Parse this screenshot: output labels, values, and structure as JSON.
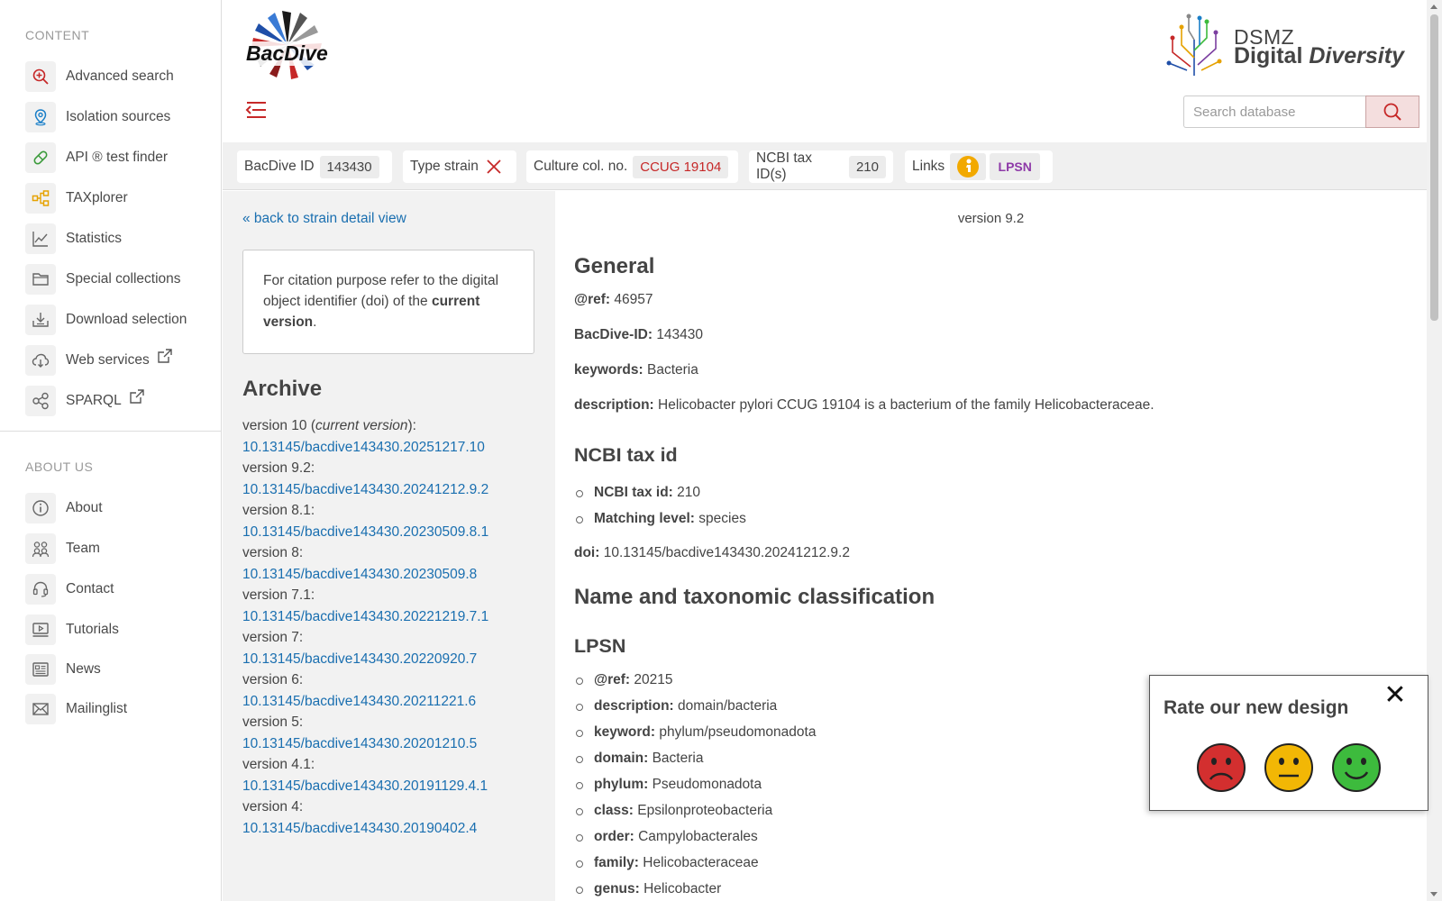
{
  "sidebar": {
    "content_heading": "CONTENT",
    "content_items": [
      {
        "label": "Advanced search",
        "icon": "magnify-plus-icon"
      },
      {
        "label": "Isolation sources",
        "icon": "location-pin-icon"
      },
      {
        "label": "API ® test finder",
        "icon": "pill-icon"
      },
      {
        "label": "TAXplorer",
        "icon": "hierarchy-icon"
      },
      {
        "label": "Statistics",
        "icon": "line-chart-icon"
      },
      {
        "label": "Special collections",
        "icon": "folder-icon"
      },
      {
        "label": "Download selection",
        "icon": "download-icon"
      },
      {
        "label": "Web services",
        "icon": "cloud-download-icon"
      },
      {
        "label": "SPARQL",
        "icon": "share-nodes-icon"
      }
    ],
    "about_heading": "ABOUT US",
    "about_items": [
      {
        "label": "About",
        "icon": "info-icon"
      },
      {
        "label": "Team",
        "icon": "team-icon"
      },
      {
        "label": "Contact",
        "icon": "headset-icon"
      },
      {
        "label": "Tutorials",
        "icon": "tutorial-video-icon"
      },
      {
        "label": "News",
        "icon": "newspaper-icon"
      },
      {
        "label": "Mailinglist",
        "icon": "envelope-icon"
      }
    ]
  },
  "header": {
    "logo_text": "BacDive",
    "partner_logo_top": "DSMZ",
    "partner_logo_bottom_a": "Digital",
    "partner_logo_bottom_b": "Diversity",
    "search_placeholder": "Search database"
  },
  "infobar": {
    "bacdive_id_label": "BacDive ID",
    "bacdive_id_value": "143430",
    "type_strain_label": "Type strain",
    "culture_label": "Culture col. no.",
    "culture_value": "CCUG 19104",
    "ncbi_label": "NCBI tax ID(s)",
    "ncbi_value": "210",
    "links_label": "Links",
    "lpsn_label": "LPSN"
  },
  "left": {
    "back_link": "« back to strain detail view",
    "citation_text": "For citation purpose refer to the digital object identifier (doi) of the ",
    "citation_bold": "current version",
    "citation_end": ".",
    "archive_title": "Archive",
    "archive": [
      {
        "version": "version 10 (",
        "current": "current version",
        "suffix": "):",
        "doi": "10.13145/bacdive143430.20251217.10"
      },
      {
        "version": "version 9.2:",
        "doi": "10.13145/bacdive143430.20241212.9.2"
      },
      {
        "version": "version 8.1:",
        "doi": "10.13145/bacdive143430.20230509.8.1"
      },
      {
        "version": "version 8:",
        "doi": "10.13145/bacdive143430.20230509.8"
      },
      {
        "version": "version 7.1:",
        "doi": "10.13145/bacdive143430.20221219.7.1"
      },
      {
        "version": "version 7:",
        "doi": "10.13145/bacdive143430.20220920.7"
      },
      {
        "version": "version 6:",
        "doi": "10.13145/bacdive143430.20211221.6"
      },
      {
        "version": "version 5:",
        "doi": "10.13145/bacdive143430.20201210.5"
      },
      {
        "version": "version 4.1:",
        "doi": "10.13145/bacdive143430.20191129.4.1"
      },
      {
        "version": "version 4:",
        "doi": "10.13145/bacdive143430.20190402.4"
      }
    ]
  },
  "main": {
    "version_label": "version 9.2",
    "general_title": "General",
    "ref_label": "@ref:",
    "ref_value": "46957",
    "id_label": "BacDive-ID:",
    "id_value": "143430",
    "keywords_label": "keywords:",
    "keywords_value": "Bacteria",
    "description_label": "description:",
    "description_value": "Helicobacter pylori CCUG 19104 is a bacterium of the family Helicobacteraceae.",
    "ncbi_title": "NCBI tax id",
    "ncbi_taxid_label": "NCBI tax id:",
    "ncbi_taxid_value": "210",
    "matching_label": "Matching level:",
    "matching_value": "species",
    "doi_label": "doi:",
    "doi_value": "10.13145/bacdive143430.20241212.9.2",
    "taxonomy_title": "Name and taxonomic classification",
    "lpsn_title": "LPSN",
    "lpsn_fields": [
      {
        "label": "@ref:",
        "value": "20215"
      },
      {
        "label": "description:",
        "value": "domain/bacteria"
      },
      {
        "label": "keyword:",
        "value": "phylum/pseudomonadota"
      },
      {
        "label": "domain:",
        "value": "Bacteria"
      },
      {
        "label": "phylum:",
        "value": "Pseudomonadota"
      },
      {
        "label": "class:",
        "value": "Epsilonproteobacteria"
      },
      {
        "label": "order:",
        "value": "Campylobacterales"
      },
      {
        "label": "family:",
        "value": "Helicobacteraceae"
      },
      {
        "label": "genus:",
        "value": "Helicobacter"
      }
    ]
  },
  "rating": {
    "title": "Rate our new design",
    "close_symbol": "✕",
    "faces": [
      "sad-face-icon",
      "neutral-face-icon",
      "happy-face-icon"
    ]
  },
  "colors": {
    "brand_red": "#c62828",
    "link_blue": "#1a6fb0",
    "sad_red": "#d32f2f",
    "neutral_yellow": "#f2b705",
    "happy_green": "#3dbb3d"
  }
}
